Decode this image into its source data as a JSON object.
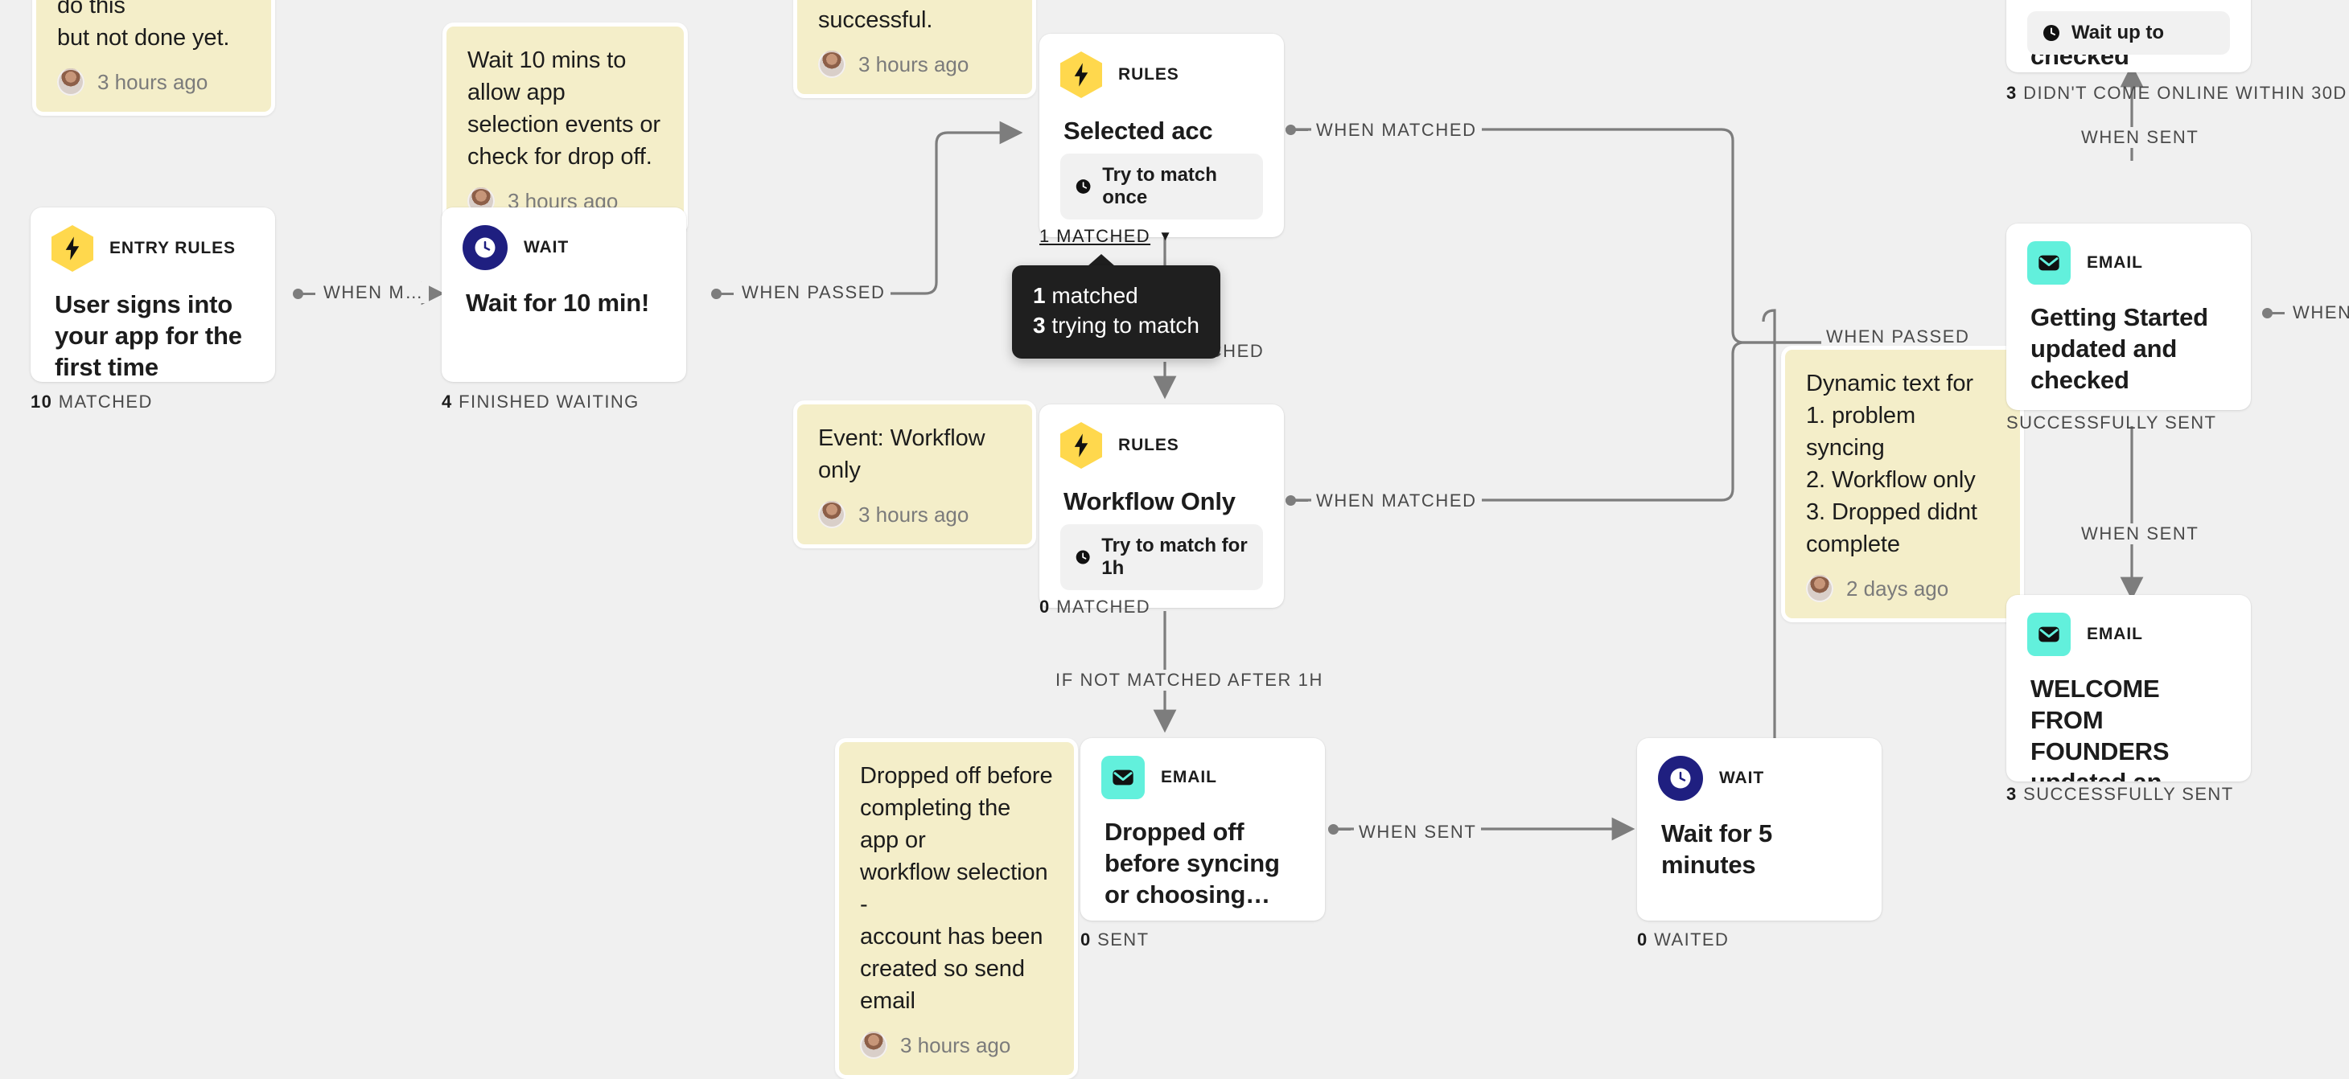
{
  "canvas": {
    "background": "#f0f0f0"
  },
  "palette": {
    "rules_icon": "#ffd84d",
    "wait_icon": "#1f1f80",
    "email_icon": "#62f0dc",
    "note_bg": "#f4eec9",
    "edge": "#7d7d7d",
    "tooltip_bg": "#1f1f1f"
  },
  "notes": [
    {
      "id": "note-partial-top-left",
      "text": "add the events to do this\nbut not done yet.",
      "time": "3 hours ago"
    },
    {
      "id": "note-wait-10-mins",
      "text": "Wait 10 mins to allow app\nselection events or\ncheck for drop off.",
      "time": "3 hours ago"
    },
    {
      "id": "note-partial-successful",
      "text": "determine if was\nsuccessful.",
      "time": "3 hours ago"
    },
    {
      "id": "note-event-workflow-only",
      "text": "Event: Workflow only",
      "time": "3 hours ago"
    },
    {
      "id": "note-dropped-off",
      "text": "Dropped off before\ncompleting the app or\nworkflow selection -\naccount has been\ncreated so send email",
      "time": "3 hours ago"
    },
    {
      "id": "note-dynamic-text",
      "text": "Dynamic text for\n1. problem syncing\n2. Workflow only\n3. Dropped didnt\ncomplete",
      "time": "2 days ago"
    }
  ],
  "nodes": [
    {
      "id": "entry-rules",
      "kind": "ENTRY RULES",
      "icon": "bolt-hexagon-icon",
      "title": "User signs into your app for the first time",
      "chip": null,
      "stat_count": "10",
      "stat_label": "MATCHED"
    },
    {
      "id": "wait-10-min",
      "kind": "WAIT",
      "icon": "clock-circle-icon",
      "title": "Wait for 10 min!",
      "chip": null,
      "stat_count": "4",
      "stat_label": "FINISHED WAITING"
    },
    {
      "id": "rules-selected-acc-app",
      "kind": "RULES",
      "icon": "bolt-hexagon-icon",
      "title": "Selected acc app",
      "chip": "Try to match once",
      "stat_count": "1",
      "stat_label": "MATCHED"
    },
    {
      "id": "rules-workflow-only",
      "kind": "RULES",
      "icon": "bolt-hexagon-icon",
      "title": "Workflow Only",
      "chip": "Try to match for 1h",
      "stat_count": "0",
      "stat_label": "MATCHED"
    },
    {
      "id": "email-dropped-off",
      "kind": "EMAIL",
      "icon": "envelope-icon",
      "title": "Dropped off before syncing or choosing…",
      "chip": null,
      "stat_count": "0",
      "stat_label": "SENT"
    },
    {
      "id": "wait-5-minutes",
      "kind": "WAIT",
      "icon": "clock-circle-icon",
      "title": "Wait for 5 minutes",
      "chip": null,
      "stat_count": "0",
      "stat_label": "WAITED"
    },
    {
      "id": "email-partial-top-right",
      "kind": "EMAIL",
      "icon": "envelope-icon",
      "title": "updated and checked",
      "chip": "Wait up to",
      "stat_count": "3",
      "stat_label": "DIDN'T COME ONLINE WITHIN 30D"
    },
    {
      "id": "email-getting-started",
      "kind": "EMAIL",
      "icon": "envelope-icon",
      "title": "Getting Started updated and checked",
      "chip": null,
      "stat_count": "",
      "stat_label": "SUCCESSFULLY SENT"
    },
    {
      "id": "email-welcome-founders",
      "kind": "EMAIL",
      "icon": "envelope-icon",
      "title": "WELCOME FROM FOUNDERS updated an…",
      "chip": null,
      "stat_count": "3",
      "stat_label": "SUCCESSFULLY SENT"
    }
  ],
  "edge_labels": {
    "when_matched_short": "WHEN M…",
    "when_passed": "WHEN PASSED",
    "when_matched_top": "WHEN MATCHED",
    "if_not_matched": "IF NOT MATCHED",
    "when_matched_mid": "WHEN MATCHED",
    "if_not_matched_after_1h": "IF NOT MATCHED AFTER 1H",
    "when_sent_bottom": "WHEN SENT",
    "when_passed_right": "WHEN PASSED",
    "when_sent_top": "WHEN SENT",
    "when_sent_mid": "WHEN SENT",
    "when_sent_right_clipped": "WHEN SE"
  },
  "tooltip": {
    "line1_count": "1",
    "line1_text": "matched",
    "line2_count": "3",
    "line2_text": "trying to match"
  },
  "matched_dropdown": {
    "label": "1 MATCHED",
    "caret": "▼"
  }
}
